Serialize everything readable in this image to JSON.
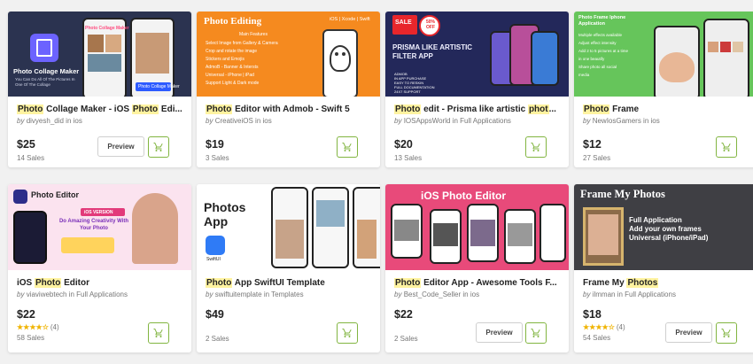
{
  "preview_label": "Preview",
  "items": [
    {
      "title_pre": "",
      "title_hl": "Photo",
      "title_post": " Collage Maker - iOS ",
      "title_hl2": "Photo",
      "title_post2": " Edi...",
      "author": "divyesh_did",
      "category": "ios",
      "price": "$25",
      "sales": "14 Sales",
      "thumb_text": "Photo Collage Maker",
      "thumb_sub": "You Can Do All Of The Pictures In One Of The Collage",
      "thumb_badge": "Photo Collage Maker"
    },
    {
      "title_pre": "",
      "title_hl": "Photo",
      "title_post": " Editor with Admob - Swift 5",
      "author": "CreativeiOS",
      "category": "ios",
      "price": "$19",
      "sales": "3 Sales",
      "thumb_text": "Photo Editing",
      "thumb_sub": "iOS | Xcode | Swift",
      "thumb_badge": "Main Features",
      "thumb_lines": [
        "Select Image from Gallery & Camera",
        "Crop and rotate the image",
        "Stickers and Emojis",
        "AdmoB - Banner & Intersts",
        "Universal - iPhone | iPad",
        "Support Light & Dark mode"
      ]
    },
    {
      "title_pre": "",
      "title_hl": "Photo",
      "title_post": " edit - Prisma like artistic ",
      "title_hl2": "phot",
      "title_post2": "...",
      "author": "IOSAppsWorld",
      "category": "Full Applications",
      "price": "$20",
      "sales": "13 Sales",
      "thumb_text": "PRISMA LIKE ARTISTIC FILTER APP",
      "thumb_badge": "SALE",
      "thumb_off": "50% OFF",
      "thumb_lines": [
        "ADMOB",
        "IN APP PURCHASE",
        "EASY TO RESKIN",
        "FULL DOCUMENTATION",
        "24X7 SUPPORT"
      ]
    },
    {
      "title_pre": "",
      "title_hl": "Photo",
      "title_post": " Frame",
      "author": "NewIosGamers",
      "category": "ios",
      "price": "$12",
      "sales": "27 Sales",
      "thumb_text": "Photo Frame Iphone Application",
      "thumb_lines": [
        "Multiple effects available",
        "Adjust effect intensity",
        "Add 2 to 5 pictures at a time",
        "in one beautify",
        "Share photo all social",
        "media"
      ]
    },
    {
      "title_pre": "iOS ",
      "title_hl": "Photo",
      "title_post": " Editor",
      "author": "viaviwebtech",
      "category": "Full Applications",
      "price": "$22",
      "rating": "(4)",
      "sales": "58 Sales",
      "thumb_text": "Photo Editor",
      "thumb_sub": "iOS VERSION",
      "thumb_badge": "Do Amazing Creativity With Your Photo"
    },
    {
      "title_pre": "",
      "title_hl": "Photo",
      "title_post": " App SwiftUI Template",
      "author": "swiftuitemplate",
      "category": "Templates",
      "price": "$49",
      "sales": "2 Sales",
      "thumb_text": "Photos App",
      "thumb_badge": "SwiftUI"
    },
    {
      "title_pre": "",
      "title_hl": "Photo",
      "title_post": " Editor App - Awesome Tools F...",
      "author": "Best_Code_Seller",
      "category": "ios",
      "price": "$22",
      "sales": "2 Sales",
      "thumb_text": "iOS Photo Editor"
    },
    {
      "title_pre": "Frame My ",
      "title_hl": "Photos",
      "title_post": "",
      "author": "ilmman",
      "category": "Full Applications",
      "price": "$18",
      "rating": "(4)",
      "sales": "54 Sales",
      "thumb_text": "Frame My Photos",
      "thumb_lines": [
        "Full Application",
        "Add your own frames",
        "Universal (iPhone/iPad)"
      ]
    }
  ],
  "colors": {
    "accent": "#82b541",
    "highlight": "#fff3a0",
    "star": "#f0b400"
  },
  "stars_glyph": "★★★★☆"
}
